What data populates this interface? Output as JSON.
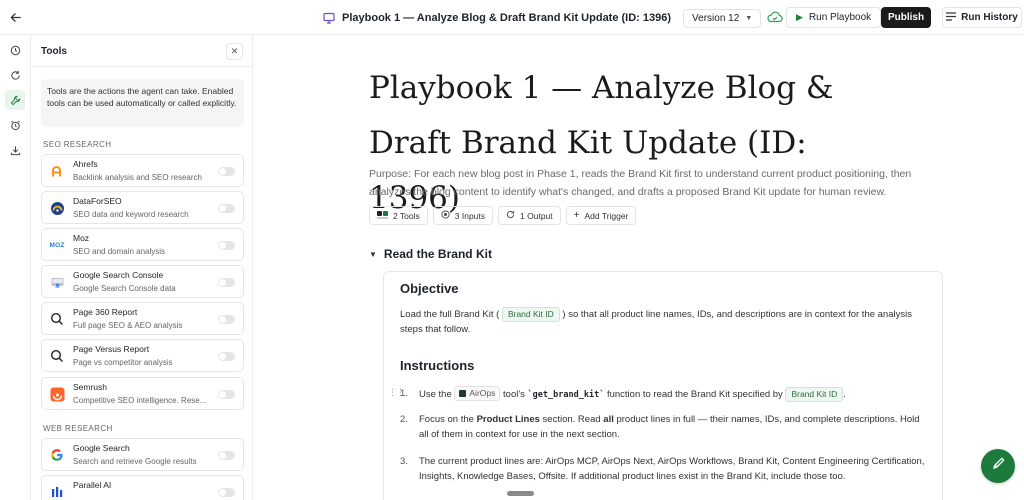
{
  "header": {
    "title": "Playbook 1 — Analyze Blog & Draft Brand Kit Update (ID: 1396)",
    "version_label": "Version 12",
    "run_label": "Run Playbook",
    "publish_label": "Publish",
    "history_label": "Run History"
  },
  "tools_panel": {
    "title": "Tools",
    "description": "Tools are the actions the agent can take. Enabled tools can be used automatically or called explicitly.",
    "sections": [
      {
        "label": "SEO RESEARCH",
        "tools": [
          {
            "name": "Ahrefs",
            "desc": "Backlink analysis and SEO research",
            "enabled": false
          },
          {
            "name": "DataForSEO",
            "desc": "SEO data and keyword research",
            "enabled": false
          },
          {
            "name": "Moz",
            "desc": "SEO and domain analysis",
            "enabled": false
          },
          {
            "name": "Google Search Console",
            "desc": "Google Search Console data",
            "enabled": false
          },
          {
            "name": "Page 360 Report",
            "desc": "Full page SEO & AEO analysis",
            "enabled": false
          },
          {
            "name": "Page Versus Report",
            "desc": "Page vs competitor analysis",
            "enabled": false
          },
          {
            "name": "Semrush",
            "desc": "Competitive SEO intelligence. Rese...",
            "enabled": false
          }
        ]
      },
      {
        "label": "WEB RESEARCH",
        "tools": [
          {
            "name": "Google Search",
            "desc": "Search and retrieve Google results",
            "enabled": false
          },
          {
            "name": "Parallel AI",
            "desc": "",
            "enabled": false
          }
        ]
      }
    ],
    "moz_logo_text": "MOZ"
  },
  "main": {
    "title": "Playbook 1 — Analyze Blog & Draft Brand Kit Update (ID: 1396)",
    "purpose": "Purpose: For each new blog post in Phase 1, reads the Brand Kit first to understand current product positioning, then analyzes the blog content to identify what's changed, and drafts a proposed Brand Kit update for human review.",
    "chips": [
      "2 Tools",
      "3 Inputs",
      "1 Output",
      "Add Trigger"
    ],
    "section_title": "Read the Brand Kit",
    "objective_heading": "Objective",
    "objective_before": "Load the full Brand Kit (",
    "objective_tag": "Brand Kit ID",
    "objective_after": ") so that all product line names, IDs, and descriptions are in context for the analysis steps that follow.",
    "instructions_heading": "Instructions",
    "instructions": [
      {
        "num": "1.",
        "p1": "Use the",
        "chip": "AirOps",
        "p2": "tool's",
        "code": "`get_brand_kit`",
        "p3": "function to read the Brand Kit specified by",
        "tag": "Brand Kit ID",
        "p4": "."
      },
      {
        "num": "2.",
        "p1": "Focus on the",
        "b1": "Product Lines",
        "p2": "section. Read",
        "b2": "all",
        "p3": "product lines in full — their names, IDs, and complete descriptions. Hold all of them in context for use in the next section."
      },
      {
        "num": "3.",
        "text": "The current product lines are: AirOps MCP, AirOps Next, AirOps Workflows, Brand Kit, Content Engineering Certification, Insights, Knowledge Bases, Offsite. If additional product lines exist in the Brand Kit, include those too."
      }
    ]
  },
  "colors": {
    "accent_green": "#1c7a3c",
    "publish_bg": "#1b1b1b",
    "tag_bg": "#eef7f1"
  }
}
